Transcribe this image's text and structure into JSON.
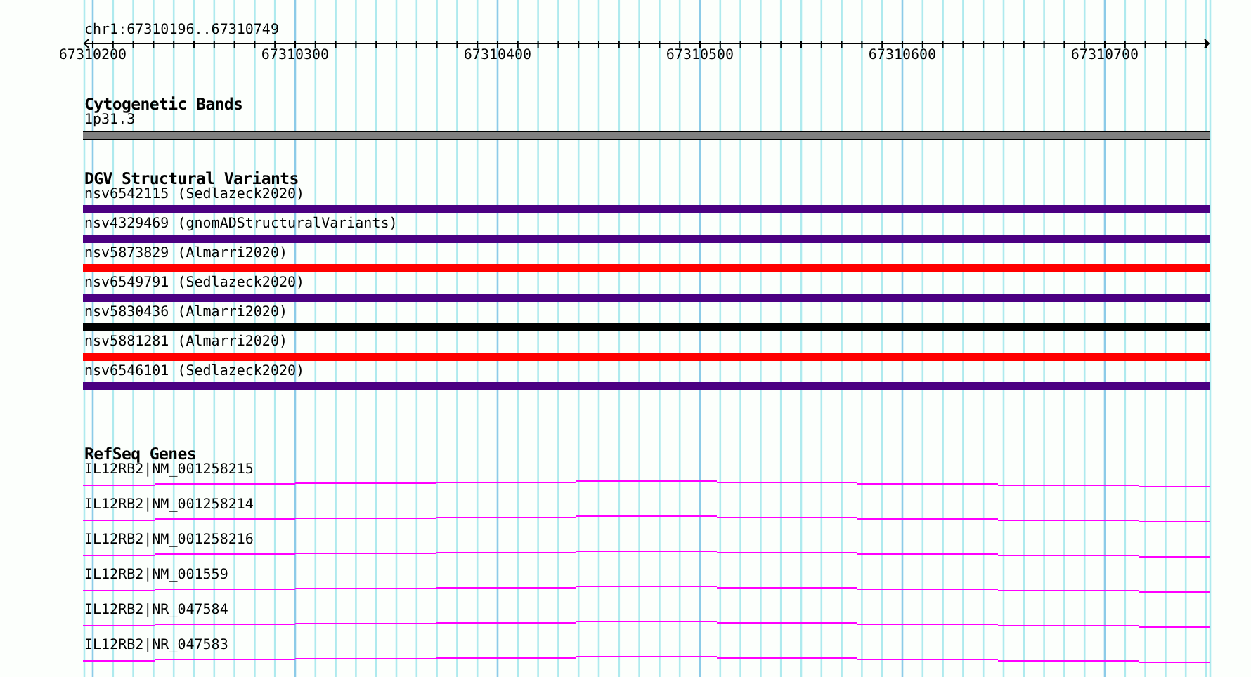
{
  "ruler": {
    "location": "chr1:67310196..67310749",
    "tick_labels": [
      "67310200",
      "67310300",
      "67310400",
      "67310500",
      "67310600",
      "67310700"
    ]
  },
  "tracks": [
    {
      "kind": "bands",
      "title": "Cytogenetic Bands",
      "features": [
        {
          "label": "1p31.3"
        }
      ]
    },
    {
      "kind": "variants",
      "title": "DGV Structural Variants",
      "features": [
        {
          "label": "nsv6542115 (Sedlazeck2020)",
          "color": "#4b0082"
        },
        {
          "label": "nsv4329469 (gnomADStructuralVariants)",
          "color": "#4b0082"
        },
        {
          "label": "nsv5873829 (Almarri2020)",
          "color": "#ff0000"
        },
        {
          "label": "nsv6549791 (Sedlazeck2020)",
          "color": "#4b0082"
        },
        {
          "label": "nsv5830436 (Almarri2020)",
          "color": "#000000"
        },
        {
          "label": "nsv5881281 (Almarri2020)",
          "color": "#ff0000"
        },
        {
          "label": "nsv6546101 (Sedlazeck2020)",
          "color": "#4b0082"
        }
      ]
    },
    {
      "kind": "genes",
      "title": "RefSeq Genes",
      "features": [
        {
          "label": "IL12RB2|NM_001258215"
        },
        {
          "label": "IL12RB2|NM_001258214"
        },
        {
          "label": "IL12RB2|NM_001258216"
        },
        {
          "label": "IL12RB2|NM_001559"
        },
        {
          "label": "IL12RB2|NR_047584"
        },
        {
          "label": "IL12RB2|NR_047583"
        }
      ]
    }
  ]
}
